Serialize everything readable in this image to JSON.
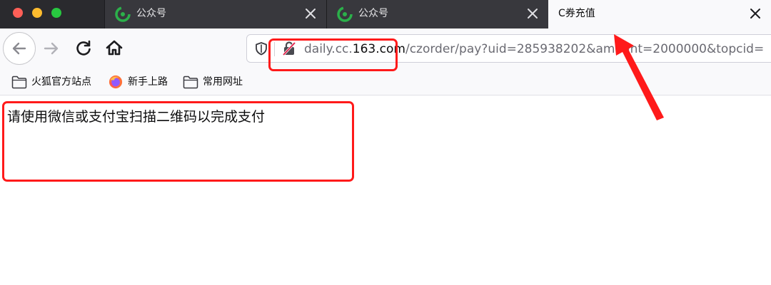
{
  "window": {
    "traffic_lights": [
      "close",
      "minimize",
      "zoom"
    ]
  },
  "tabs": [
    {
      "title": "公众号",
      "favicon": "wechat-mp-icon",
      "active": false
    },
    {
      "title": "公众号",
      "favicon": "wechat-mp-icon",
      "active": false
    },
    {
      "title": "C券充值",
      "favicon": "",
      "active": true
    }
  ],
  "nav": {
    "url_prefix": "daily.cc.",
    "url_domain": "163.com",
    "url_path": "/czorder/pay?uid=285938202&amount=2000000&topcid=",
    "icons": [
      "back-arrow-icon",
      "forward-arrow-icon",
      "reload-icon",
      "home-icon",
      "tracking-shield-icon",
      "insecure-lock-icon"
    ]
  },
  "bookmarks": [
    {
      "label": "火狐官方站点",
      "icon": "folder-icon"
    },
    {
      "label": "新手上路",
      "icon": "firefox-icon"
    },
    {
      "label": "常用网址",
      "icon": "folder-icon"
    }
  ],
  "page": {
    "message": "请使用微信或支付宝扫描二维码以完成支付"
  },
  "colors": {
    "annotation": "#ff1a1a",
    "tabstrip": "#2a2a2e",
    "toolbar": "#f9f9fb"
  }
}
